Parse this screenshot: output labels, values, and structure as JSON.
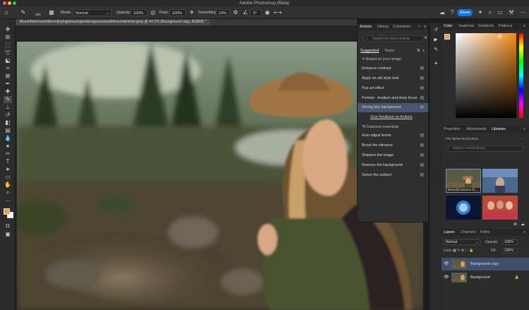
{
  "app": {
    "title": "Adobe Photoshop (Beta)"
  },
  "options_bar": {
    "brush_size": "300",
    "mode_label": "Mode:",
    "mode_value": "Normal",
    "opacity_label": "Opacity:",
    "opacity_value": "100%",
    "flow_label": "Flow:",
    "flow_value": "100%",
    "smoothing_label": "Smoothing:",
    "smoothing_value": "10%",
    "angle_value": "0°",
    "share_label": "Share"
  },
  "document": {
    "tab_title": "Beautifulwomanhikerenjoyingamazinglandscapesnearwildmountainriver.jpeg @ 44.1% (Background copy, RGB/8) *"
  },
  "actions_panel": {
    "tabs": [
      "Actions",
      "History",
      "Comments"
    ],
    "search_placeholder": "Search for more actions",
    "subtabs": [
      "Suggested",
      "Yours"
    ],
    "section_based": "Based on your image",
    "based_items": [
      "Enhance contrast",
      "Apply an old style look",
      "Pop art effect",
      "Portrait - medium and deep focus",
      "Strong blur background"
    ],
    "feedback_link": "Give feedback on Actions",
    "section_featured": "Featured essentials",
    "featured_items": [
      "Auto adjust levels",
      "Boost the vibrance",
      "Sharpen the image",
      "Remove the background",
      "Select the subject"
    ]
  },
  "color_panel": {
    "tabs": [
      "Color",
      "Swatches",
      "Gradients",
      "Patterns"
    ],
    "foreground": "#e8a24a"
  },
  "libraries_panel": {
    "tabs": [
      "Properties",
      "Adjustments",
      "Libraries"
    ],
    "banner": "PS NEW FEATURES",
    "search_placeholder": "Search current library",
    "thumb_caption": "Beautiful woman hi..."
  },
  "layers_panel": {
    "tabs": [
      "Layers",
      "Channels",
      "Paths"
    ],
    "blend_mode": "Normal",
    "opacity_label": "Opacity:",
    "opacity_value": "100%",
    "lock_label": "Lock:",
    "fill_label": "Fill:",
    "fill_value": "100%",
    "layers": [
      "Background copy",
      "Background"
    ]
  },
  "colors": {
    "selection": "#4a5670",
    "accent": "#1473e6",
    "foreground_swatch": "#e8a24a"
  }
}
